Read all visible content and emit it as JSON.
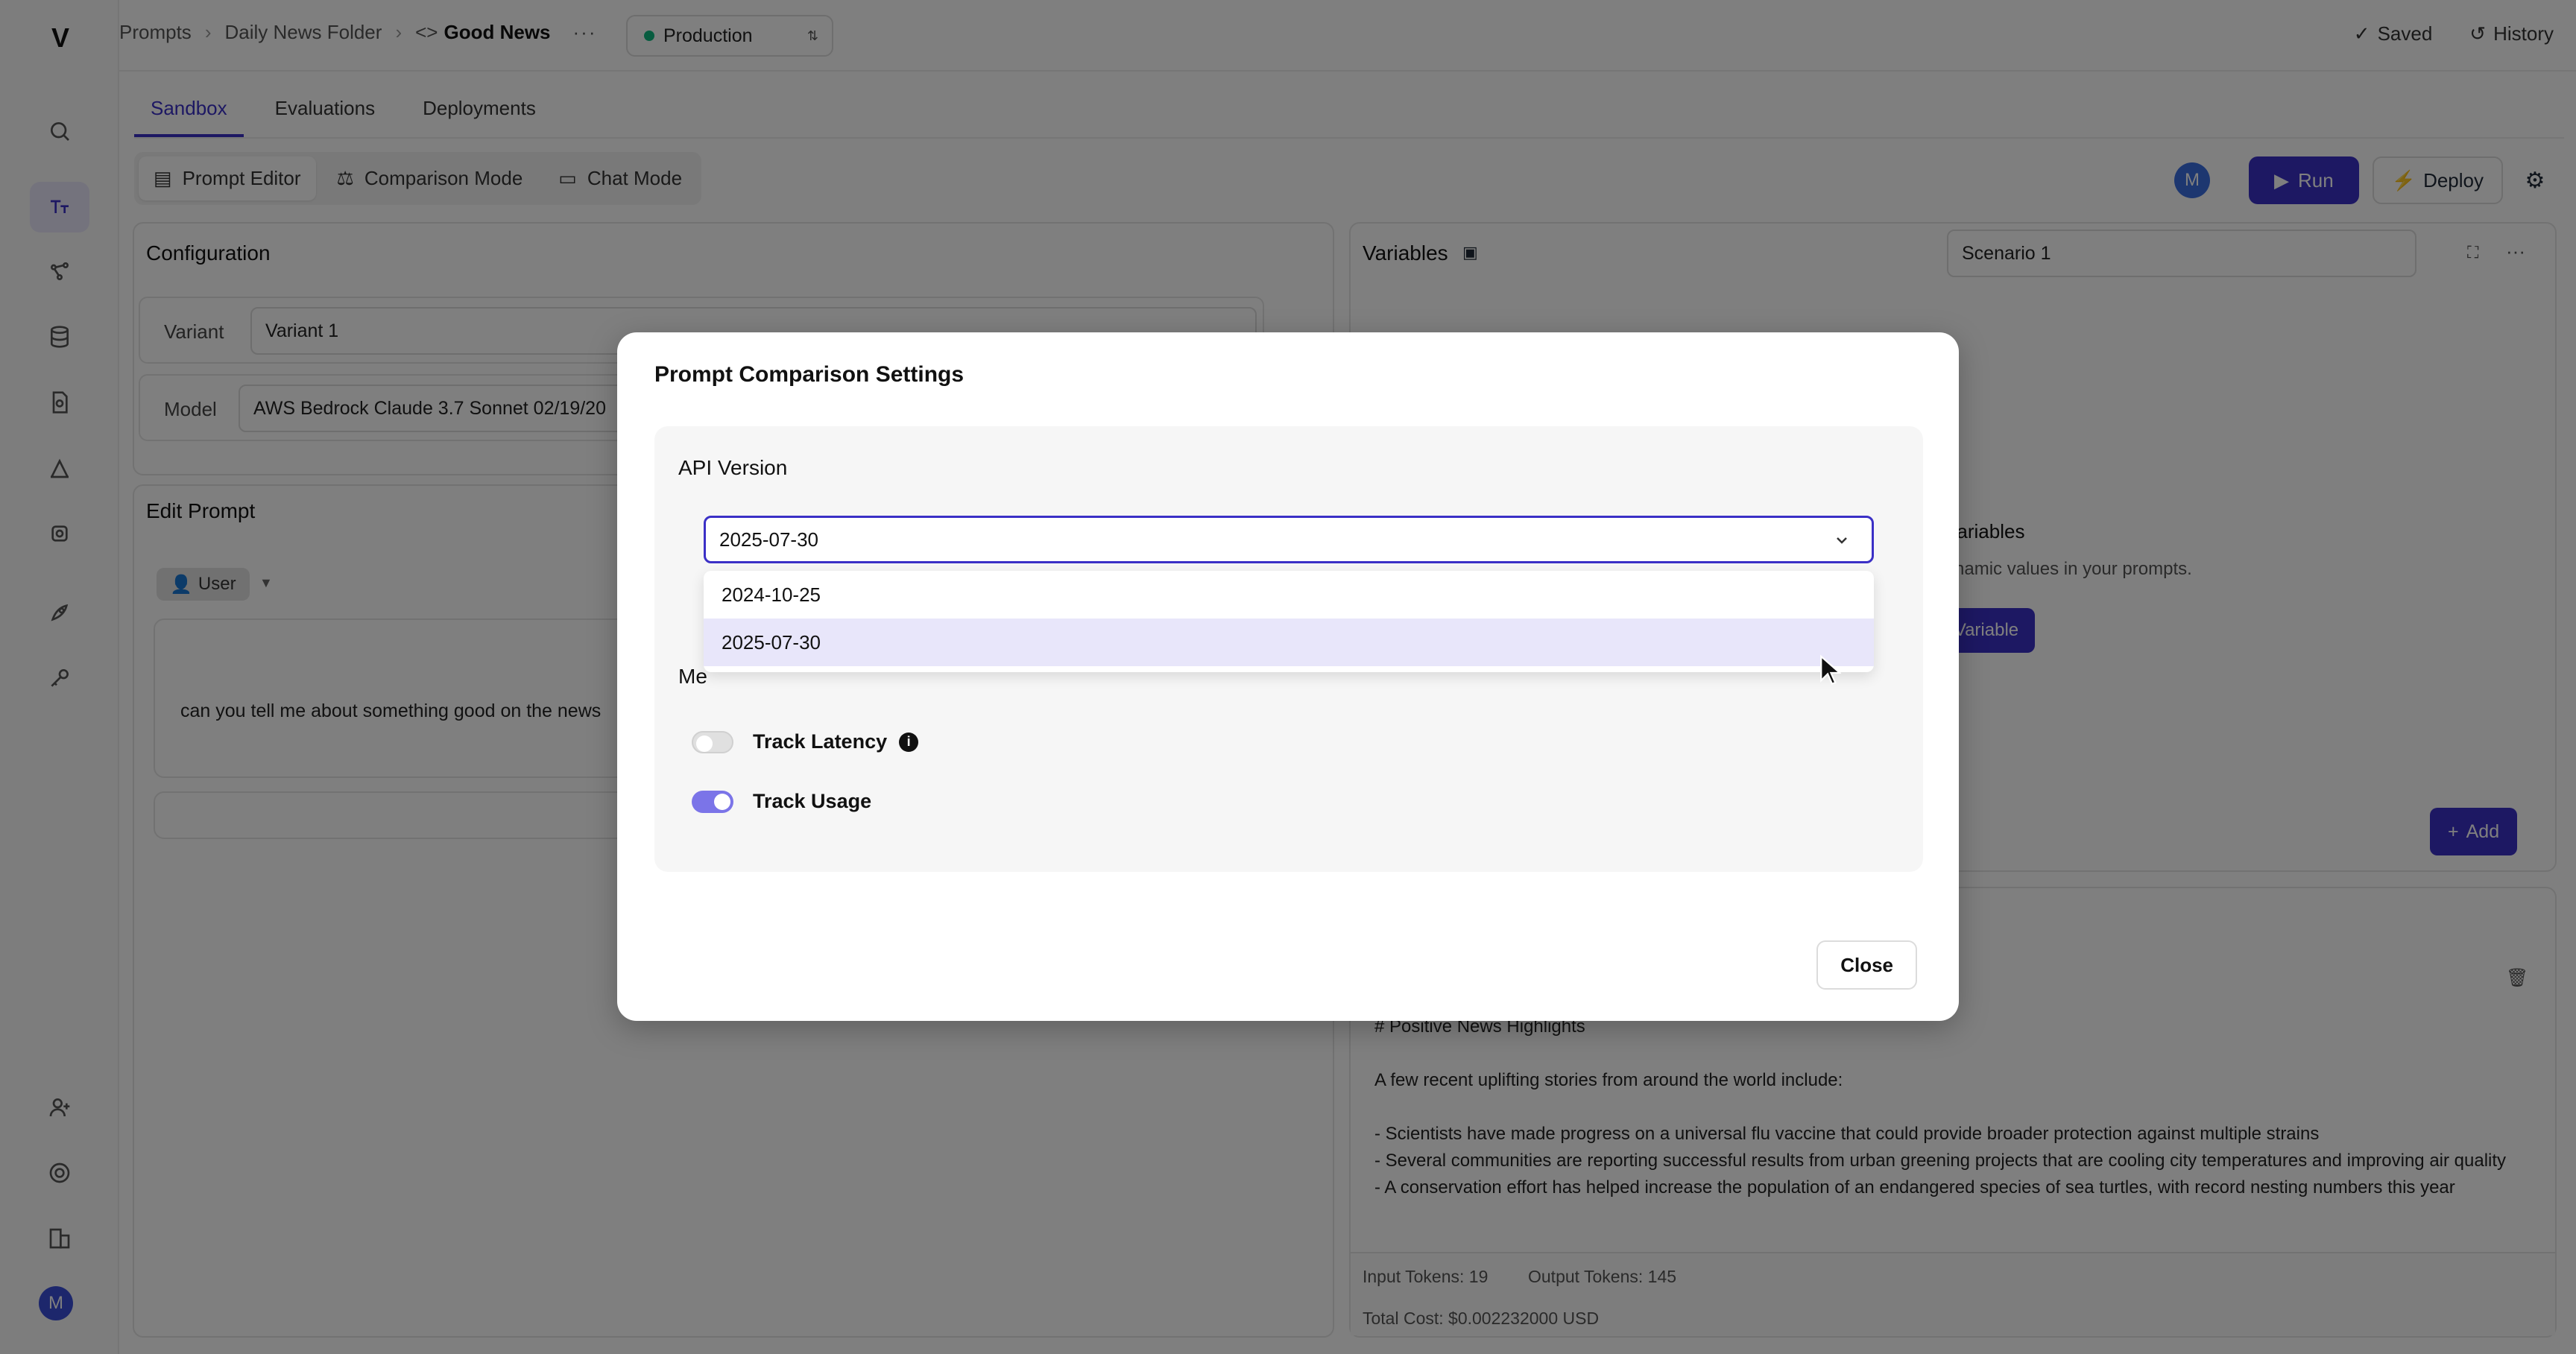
{
  "app": {
    "logo": "V"
  },
  "breadcrumb": {
    "items": [
      "Prompts",
      "Daily News Folder"
    ],
    "current": "Good News",
    "current_icon": "<>",
    "more": "···"
  },
  "environment": {
    "label": "Production",
    "status_color": "#10b981"
  },
  "header_right": {
    "saved": "Saved",
    "history": "History"
  },
  "tabs": [
    {
      "label": "Sandbox",
      "active": true
    },
    {
      "label": "Evaluations",
      "active": false
    },
    {
      "label": "Deployments",
      "active": false
    }
  ],
  "modes": [
    {
      "label": "Prompt Editor",
      "active": true
    },
    {
      "label": "Comparison Mode",
      "active": false
    },
    {
      "label": "Chat Mode",
      "active": false
    }
  ],
  "toolbar": {
    "avatar": "M",
    "run": "Run",
    "deploy": "Deploy"
  },
  "config": {
    "title": "Configuration",
    "variant_label": "Variant",
    "variant_value": "Variant 1",
    "model_label": "Model",
    "model_value": "AWS Bedrock Claude 3.7 Sonnet 02/19/20"
  },
  "edit_prompt": {
    "title": "Edit Prompt",
    "role": "User",
    "message": "can you tell me about something good on the news"
  },
  "variables": {
    "title": "Variables",
    "scenario": "Scenario 1",
    "empty_title": "Variables",
    "empty_text": "ynamic values in your prompts.",
    "add_variable": "Variable",
    "add": "Add"
  },
  "response": {
    "lines": [
      "# Positive News Highlights",
      "",
      "A few recent uplifting stories from around the world include:",
      "",
      "- Scientists have made progress on a universal flu vaccine that could provide broader protection against multiple strains",
      "- Several communities are reporting successful results from urban greening projects that are cooling city temperatures and improving air quality",
      "- A conservation effort has helped increase the population of an endangered species of sea turtles, with record nesting numbers this year"
    ],
    "input_tokens": "Input Tokens: 19",
    "output_tokens": "Output Tokens: 145",
    "total_cost": "Total Cost: $0.002232000 USD"
  },
  "modal": {
    "title": "Prompt Comparison Settings",
    "api_version_label": "API Version",
    "api_version_value": "2025-07-30",
    "options": [
      {
        "label": "2024-10-25",
        "selected": false
      },
      {
        "label": "2025-07-30",
        "selected": true
      }
    ],
    "metrics_label": "Me",
    "track_latency": {
      "label": "Track Latency",
      "enabled": false
    },
    "track_usage": {
      "label": "Track Usage",
      "enabled": true
    },
    "close": "Close"
  },
  "colors": {
    "accent": "#3b30c6",
    "toggle_on": "#7b74e8",
    "selected_option": "#e8e6fa"
  }
}
